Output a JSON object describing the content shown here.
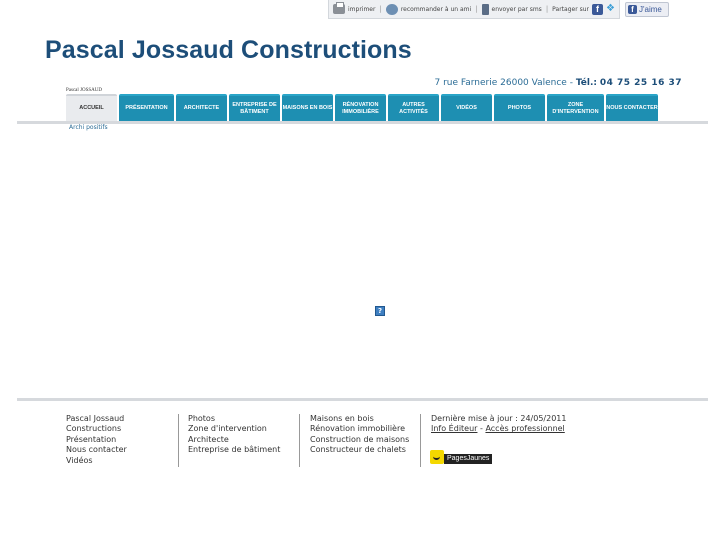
{
  "sharebar": {
    "print_label": "imprimer",
    "recommend_label": "recommander à un ami",
    "sms_label": "envoyer par sms",
    "share_label": "Partager sur"
  },
  "like_button": {
    "label": "J'aime"
  },
  "site": {
    "title": "Pascal Jossaud Constructions",
    "address": "7 rue Farnerie 26000 Valence  - ",
    "tel_label": "Tél.:",
    "tel": "04 75 25 16 37",
    "logo_line1": "Pascal JOSSAUD"
  },
  "nav": {
    "items": [
      {
        "label": "Accueil"
      },
      {
        "label": "Présentation"
      },
      {
        "label": "Architecte"
      },
      {
        "label": "Entreprise de bâtiment"
      },
      {
        "label": "Maisons en bois"
      },
      {
        "label": "Rénovation immobilière"
      },
      {
        "label": "Autres activités"
      },
      {
        "label": "Vidéos"
      },
      {
        "label": "Photos"
      },
      {
        "label": "Zone d'intervention"
      },
      {
        "label": "Nous contacter"
      }
    ],
    "sub_item": "Archi positifs"
  },
  "plugin_placeholder": "?",
  "footer": {
    "col1": [
      "Pascal Jossaud",
      "Constructions",
      "Présentation",
      "Nous contacter",
      "Vidéos"
    ],
    "col2": [
      "Photos",
      "Zone d'intervention",
      "Architecte",
      "Entreprise de bâtiment"
    ],
    "col3": [
      "Maisons en bois",
      "Rénovation immobilière",
      "Construction de maisons",
      "Constructeur de chalets"
    ],
    "updated": "Dernière mise à jour : 24/05/2011",
    "info_editeur": "Info Éditeur",
    "dash": " - ",
    "acces_pro": "Accès professionnel",
    "pagesjaunes": "PagesJaunes"
  }
}
